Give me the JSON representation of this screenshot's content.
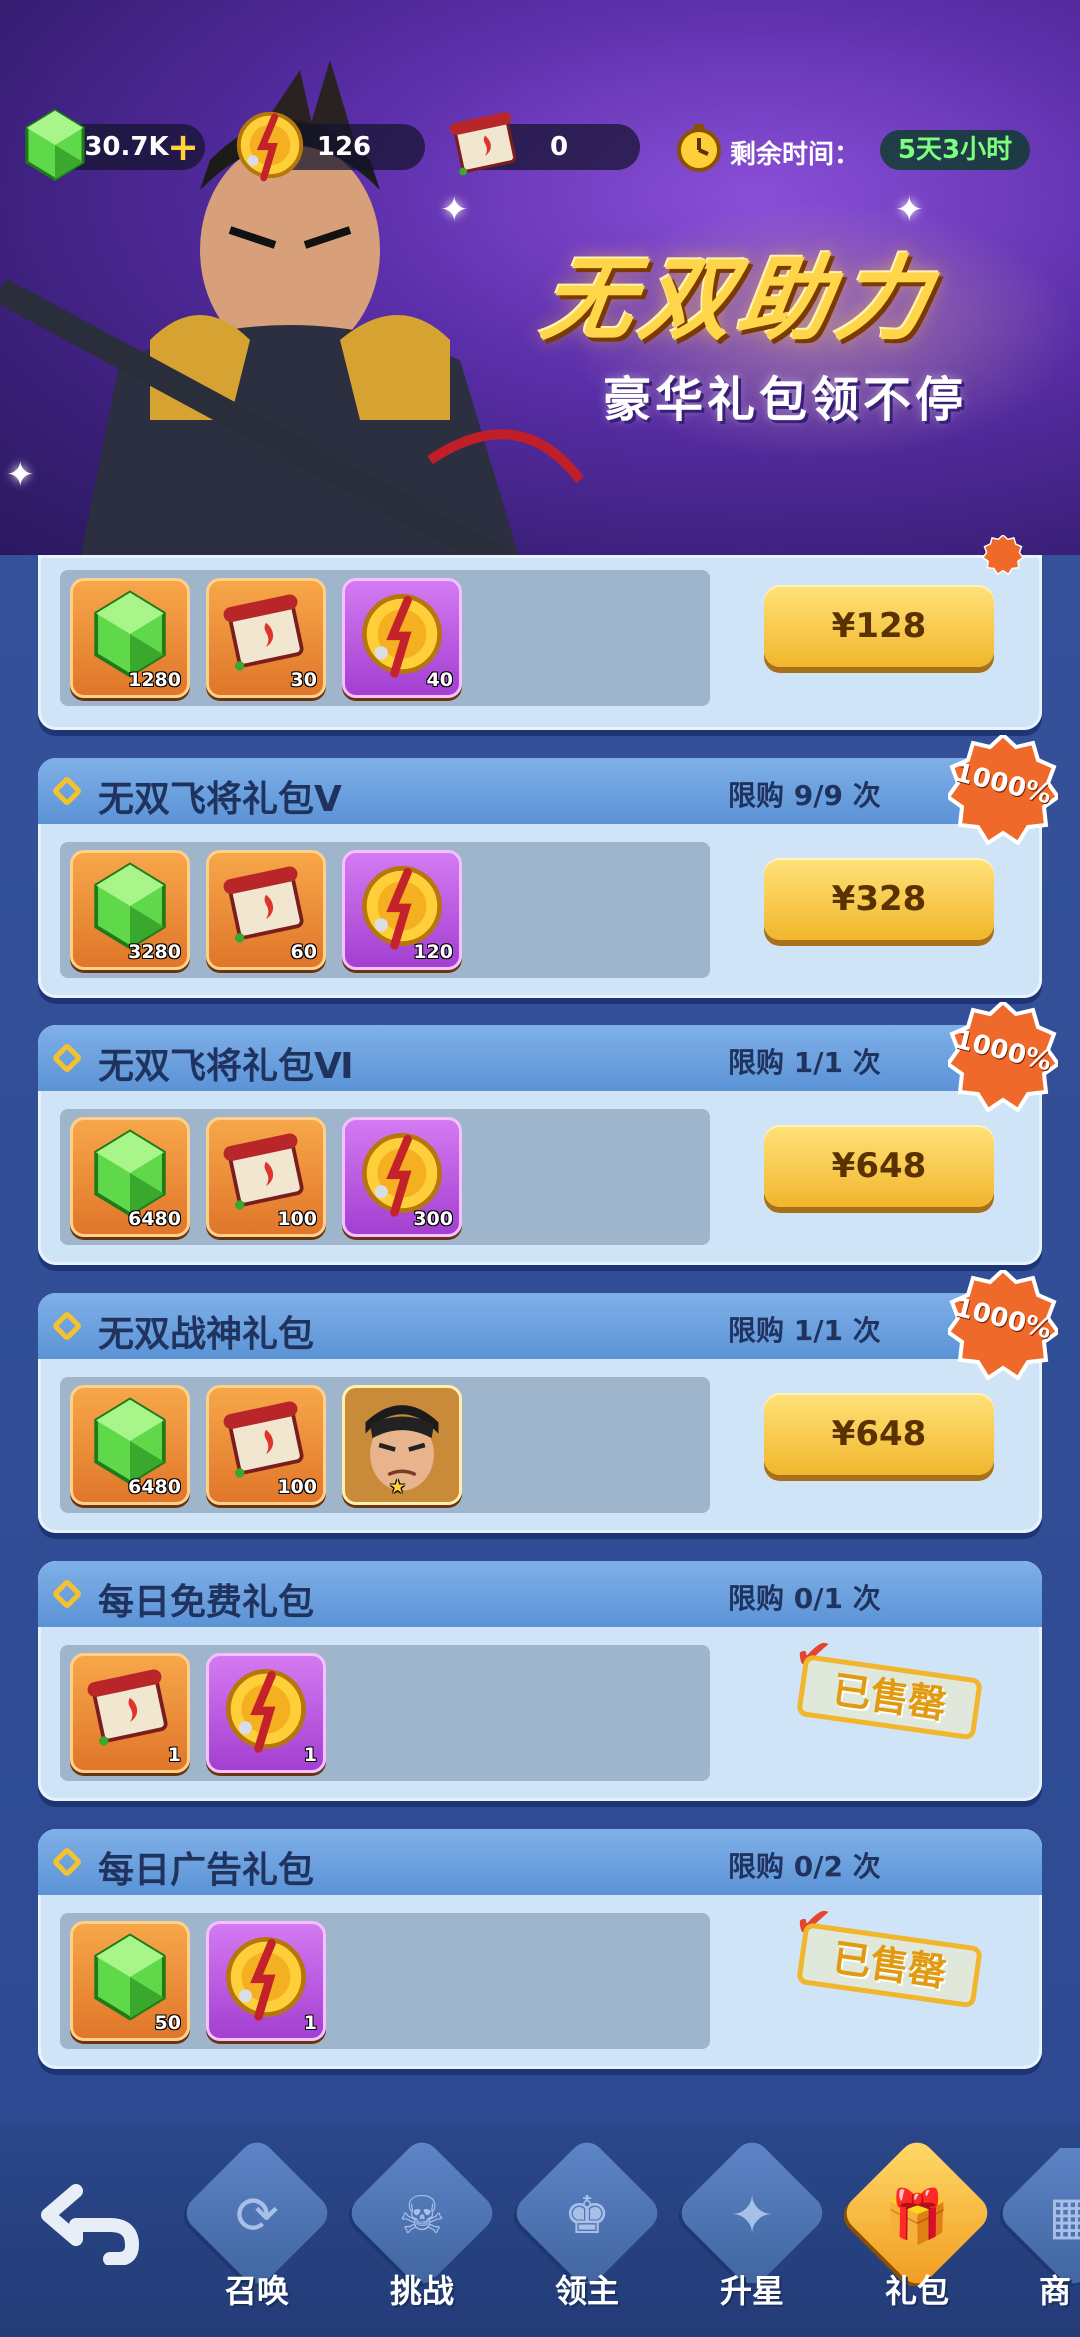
{
  "resources": {
    "gems": "30.7K",
    "coins": "126",
    "scrolls": "0"
  },
  "timer": {
    "label": "剩余时间：",
    "value": "5天3小时"
  },
  "banner": {
    "title": "无双助力",
    "subtitle": "豪华礼包领不停"
  },
  "packs": [
    {
      "title": "",
      "limit": "",
      "price": "¥128",
      "badge": "",
      "items": [
        {
          "type": "gem",
          "qty": "1280"
        },
        {
          "type": "scroll",
          "qty": "30"
        },
        {
          "type": "coin",
          "qty": "40"
        }
      ]
    },
    {
      "title": "无双飞将礼包Ⅴ",
      "limit": "限购 9/9 次",
      "price": "¥328",
      "badge": "1000%",
      "items": [
        {
          "type": "gem",
          "qty": "3280"
        },
        {
          "type": "scroll",
          "qty": "60"
        },
        {
          "type": "coin",
          "qty": "120"
        }
      ]
    },
    {
      "title": "无双飞将礼包Ⅵ",
      "limit": "限购 1/1 次",
      "price": "¥648",
      "badge": "1000%",
      "items": [
        {
          "type": "gem",
          "qty": "6480"
        },
        {
          "type": "scroll",
          "qty": "100"
        },
        {
          "type": "coin",
          "qty": "300"
        }
      ]
    },
    {
      "title": "无双战神礼包",
      "limit": "限购 1/1 次",
      "price": "¥648",
      "badge": "1000%",
      "items": [
        {
          "type": "gem",
          "qty": "6480"
        },
        {
          "type": "scroll",
          "qty": "100"
        },
        {
          "type": "hero",
          "qty": ""
        }
      ]
    },
    {
      "title": "每日免费礼包",
      "limit": "限购 0/1 次",
      "sold": "已售罄",
      "items": [
        {
          "type": "scroll",
          "qty": "1"
        },
        {
          "type": "coin",
          "qty": "1"
        }
      ]
    },
    {
      "title": "每日广告礼包",
      "limit": "限购 0/2 次",
      "sold": "已售罄",
      "items": [
        {
          "type": "gem",
          "qty": "50"
        },
        {
          "type": "coin",
          "qty": "1"
        }
      ]
    }
  ],
  "nav": {
    "tabs": [
      {
        "label": "召唤",
        "glyph": "⟳"
      },
      {
        "label": "挑战",
        "glyph": "☠"
      },
      {
        "label": "领主",
        "glyph": "♚"
      },
      {
        "label": "升星",
        "glyph": "✦"
      },
      {
        "label": "礼包",
        "glyph": "🎁"
      },
      {
        "label": "商",
        "glyph": "▦"
      }
    ],
    "active": "礼包"
  }
}
